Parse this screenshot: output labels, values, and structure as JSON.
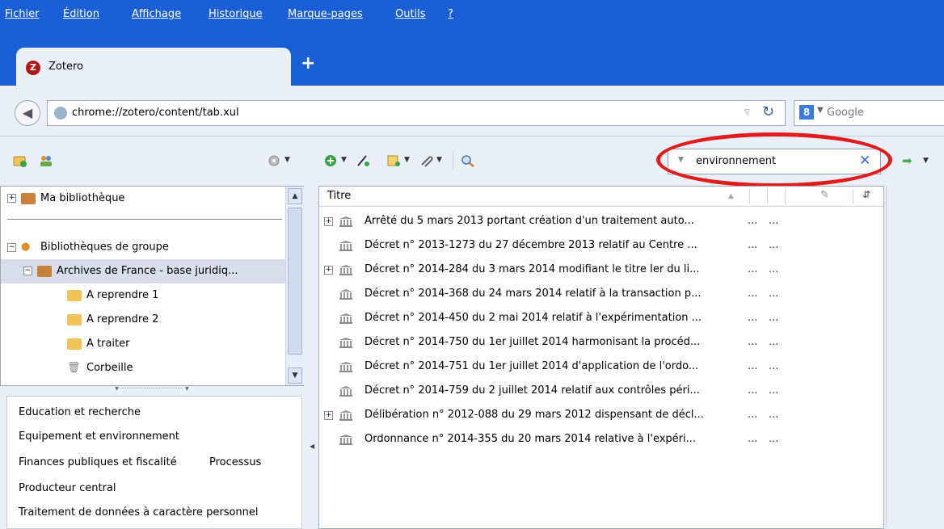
{
  "menu": [
    "Fichier",
    "Édition",
    "Affichage",
    "Historique",
    "Marque-pages",
    "Outils",
    "?"
  ],
  "tab": {
    "icon_letter": "Z",
    "label": "Zotero",
    "new_tab": "+"
  },
  "nav": {
    "url": "chrome://zotero/content/tab.xul",
    "search_badge": "8",
    "search_placeholder": "Google"
  },
  "toolbar": {
    "search_value": "environnement",
    "clear": "✕",
    "go": "➡"
  },
  "collections": {
    "my_library": "Ma bibliothèque",
    "groups": "Bibliothèques de groupe",
    "group_name": "Archives de France - base juridiq...",
    "subfolders": [
      "A reprendre 1",
      "A reprendre 2",
      "A traiter"
    ],
    "trash": "Corbeille"
  },
  "tags": [
    "Education et recherche",
    "Equipement et environnement",
    "Finances publiques et fiscalité",
    "Processus",
    "Producteur central",
    "Traitement de données à caractère personnel"
  ],
  "items": {
    "header_title": "Titre",
    "rows": [
      {
        "title": "Arrêté du 5 mars 2013 portant création d'un traitement auto...",
        "c1": "...",
        "c2": "...",
        "expandable": true
      },
      {
        "title": "Décret n° 2013-1273 du 27 décembre 2013 relatif au Centre ...",
        "c1": "...",
        "c2": "...",
        "expandable": false
      },
      {
        "title": "Décret n° 2014-284 du 3 mars 2014 modifiant le titre Ier du li...",
        "c1": "...",
        "c2": "...",
        "expandable": true
      },
      {
        "title": "Décret n° 2014-368 du 24 mars 2014 relatif à la transaction p...",
        "c1": "...",
        "c2": "...",
        "expandable": false
      },
      {
        "title": "Décret n° 2014-450 du 2 mai 2014 relatif à l'expérimentation ...",
        "c1": "...",
        "c2": "...",
        "expandable": false
      },
      {
        "title": "Décret n° 2014-750 du 1er juillet 2014 harmonisant la procéd...",
        "c1": "...",
        "c2": "...",
        "expandable": false
      },
      {
        "title": "Décret n° 2014-751 du 1er juillet 2014 d'application de l'ordo...",
        "c1": "...",
        "c2": "...",
        "expandable": false
      },
      {
        "title": "Décret n° 2014-759 du 2 juillet 2014 relatif aux contrôles péri...",
        "c1": "...",
        "c2": "...",
        "expandable": false
      },
      {
        "title": "Délibération n° 2012-088 du 29 mars 2012 dispensant de décl...",
        "c1": "...",
        "c2": "...",
        "expandable": true
      },
      {
        "title": "Ordonnance n° 2014-355 du 20 mars 2014 relative à l'expéri...",
        "c1": "...",
        "c2": "...",
        "expandable": false
      }
    ]
  },
  "colors": {
    "titlebar": "#1a5fd6",
    "highlight_ring": "#e21b1b",
    "folder": "#f1c45a",
    "library_box": "#c9813a"
  }
}
